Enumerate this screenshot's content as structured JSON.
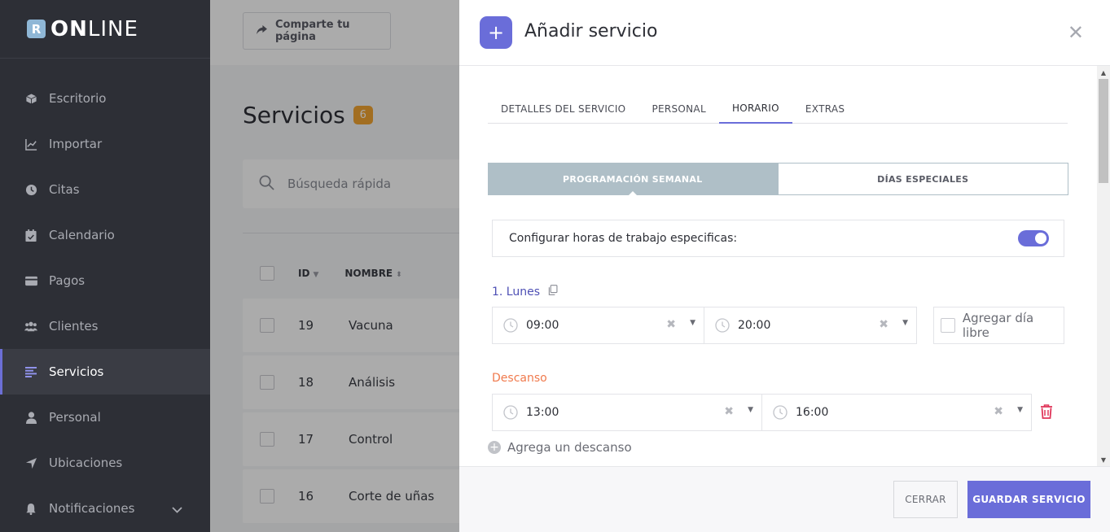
{
  "app": {
    "logo_mark": "R",
    "logo_bold": "ON",
    "logo_rest": "LINE"
  },
  "sidebar": {
    "items": [
      {
        "label": "Escritorio",
        "icon": "cube-icon"
      },
      {
        "label": "Importar",
        "icon": "chart-line-icon"
      },
      {
        "label": "Citas",
        "icon": "clock-icon"
      },
      {
        "label": "Calendario",
        "icon": "calendar-check-icon"
      },
      {
        "label": "Pagos",
        "icon": "wallet-icon"
      },
      {
        "label": "Clientes",
        "icon": "users-icon"
      },
      {
        "label": "Servicios",
        "icon": "list-icon",
        "active": true
      },
      {
        "label": "Personal",
        "icon": "user-icon"
      },
      {
        "label": "Ubicaciones",
        "icon": "location-arrow-icon"
      },
      {
        "label": "Notificaciones",
        "icon": "bell-icon"
      }
    ]
  },
  "topbar": {
    "share_label": "Comparte tu página"
  },
  "services_page": {
    "title": "Servicios",
    "count": "6",
    "search_placeholder": "Búsqueda rápida",
    "columns": {
      "id": "ID",
      "name": "NOMBRE"
    },
    "rows": [
      {
        "id": "19",
        "name": "Vacuna"
      },
      {
        "id": "18",
        "name": "Análisis"
      },
      {
        "id": "17",
        "name": "Control"
      },
      {
        "id": "16",
        "name": "Corte de uñas"
      }
    ]
  },
  "modal": {
    "title": "Añadir servicio",
    "tabs": [
      "DETALLES DEL SERVICIO",
      "PERSONAL",
      "HORARIO",
      "EXTRAS"
    ],
    "active_tab": "HORARIO",
    "segments": {
      "weekly": "PROGRAMACIÓN SEMANAL",
      "special": "DÍAS ESPECIALES"
    },
    "config_label": "Configurar horas de trabajo especificas:",
    "config_enabled": true,
    "day": {
      "label": "1. Lunes",
      "start": "09:00",
      "end": "20:00",
      "day_off_label": "Agregar día libre"
    },
    "break": {
      "label": "Descanso",
      "start": "13:00",
      "end": "16:00",
      "add_label": "Agrega un descanso"
    },
    "footer": {
      "close_label": "CERRAR",
      "save_label": "GUARDAR SERVICIO"
    }
  },
  "colors": {
    "accent": "#6a6dd9",
    "sidebar_bg": "#2d2f36",
    "break_label": "#f07a4d",
    "badge": "#f2a532",
    "trash": "#e0365a"
  }
}
